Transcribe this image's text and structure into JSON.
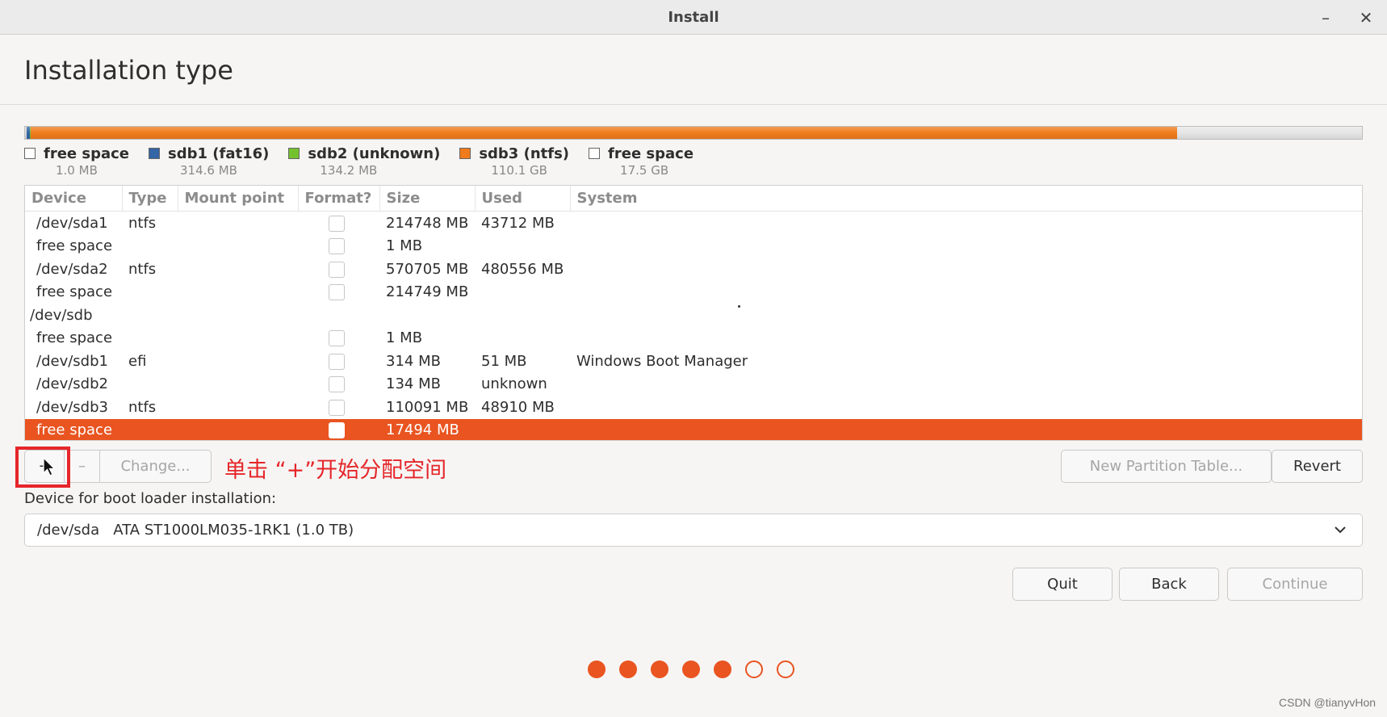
{
  "window": {
    "title": "Install",
    "minimize_glyph": "–",
    "close_glyph": "✕"
  },
  "page": {
    "heading": "Installation type"
  },
  "disk_bar": {
    "segments": [
      {
        "name": "free space",
        "color": "#d8d8d8",
        "fraction": 0.001
      },
      {
        "name": "sdb1 (fat16)",
        "color": "#3465a4",
        "fraction": 0.0024
      },
      {
        "name": "sdb2 (unknown)",
        "color": "#73c22d",
        "fraction": 0.0011
      },
      {
        "name": "sdb3 (ntfs)",
        "color": "#f07b1c",
        "fraction": 0.8575
      },
      {
        "name": "free space",
        "color": "#e6e6e6",
        "fraction": 0.138
      }
    ]
  },
  "legend": [
    {
      "name": "free space",
      "size": "1.0 MB",
      "color": "#ffffff"
    },
    {
      "name": "sdb1 (fat16)",
      "size": "314.6 MB",
      "color": "#3465a4"
    },
    {
      "name": "sdb2 (unknown)",
      "size": "134.2 MB",
      "color": "#73c22d"
    },
    {
      "name": "sdb3 (ntfs)",
      "size": "110.1 GB",
      "color": "#f07b1c"
    },
    {
      "name": "free space",
      "size": "17.5 GB",
      "color": "#ffffff"
    }
  ],
  "table": {
    "columns": [
      "Device",
      "Type",
      "Mount point",
      "Format?",
      "Size",
      "Used",
      "System"
    ],
    "rows": [
      {
        "kind": "part",
        "device": "/dev/sda1",
        "type": "ntfs",
        "mount": "",
        "format": true,
        "size": "214748 MB",
        "used": "43712 MB",
        "system": ""
      },
      {
        "kind": "part",
        "device": "free space",
        "type": "",
        "mount": "",
        "format": true,
        "size": "1 MB",
        "used": "",
        "system": ""
      },
      {
        "kind": "part",
        "device": "/dev/sda2",
        "type": "ntfs",
        "mount": "",
        "format": true,
        "size": "570705 MB",
        "used": "480556 MB",
        "system": ""
      },
      {
        "kind": "part",
        "device": "free space",
        "type": "",
        "mount": "",
        "format": true,
        "size": "214749 MB",
        "used": "",
        "system": ""
      },
      {
        "kind": "disk",
        "device": "/dev/sdb",
        "type": "",
        "mount": "",
        "format": false,
        "size": "",
        "used": "",
        "system": ""
      },
      {
        "kind": "part",
        "device": "free space",
        "type": "",
        "mount": "",
        "format": true,
        "size": "1 MB",
        "used": "",
        "system": ""
      },
      {
        "kind": "part",
        "device": "/dev/sdb1",
        "type": "efi",
        "mount": "",
        "format": true,
        "size": "314 MB",
        "used": "51 MB",
        "system": "Windows Boot Manager"
      },
      {
        "kind": "part",
        "device": "/dev/sdb2",
        "type": "",
        "mount": "",
        "format": true,
        "size": "134 MB",
        "used": "unknown",
        "system": ""
      },
      {
        "kind": "part",
        "device": "/dev/sdb3",
        "type": "ntfs",
        "mount": "",
        "format": true,
        "size": "110091 MB",
        "used": "48910 MB",
        "system": ""
      },
      {
        "kind": "part",
        "device": "free space",
        "type": "",
        "mount": "",
        "format": true,
        "size": "17494 MB",
        "used": "",
        "system": "",
        "selected": true
      }
    ]
  },
  "partition_buttons": {
    "add": "+",
    "remove": "–",
    "change": "Change..."
  },
  "annotation": "单击 “+”开始分配空间",
  "right_buttons": {
    "new_partition_table": "New Partition Table...",
    "revert": "Revert"
  },
  "bootloader": {
    "label": "Device for boot loader installation:",
    "selected": "/dev/sda   ATA ST1000LM035-1RK1 (1.0 TB)"
  },
  "nav_buttons": {
    "quit": "Quit",
    "back": "Back",
    "continue": "Continue"
  },
  "progress": {
    "total_steps": 7,
    "completed_steps": 5,
    "accent": "#e95420"
  },
  "watermark": "CSDN @tianyvHon"
}
